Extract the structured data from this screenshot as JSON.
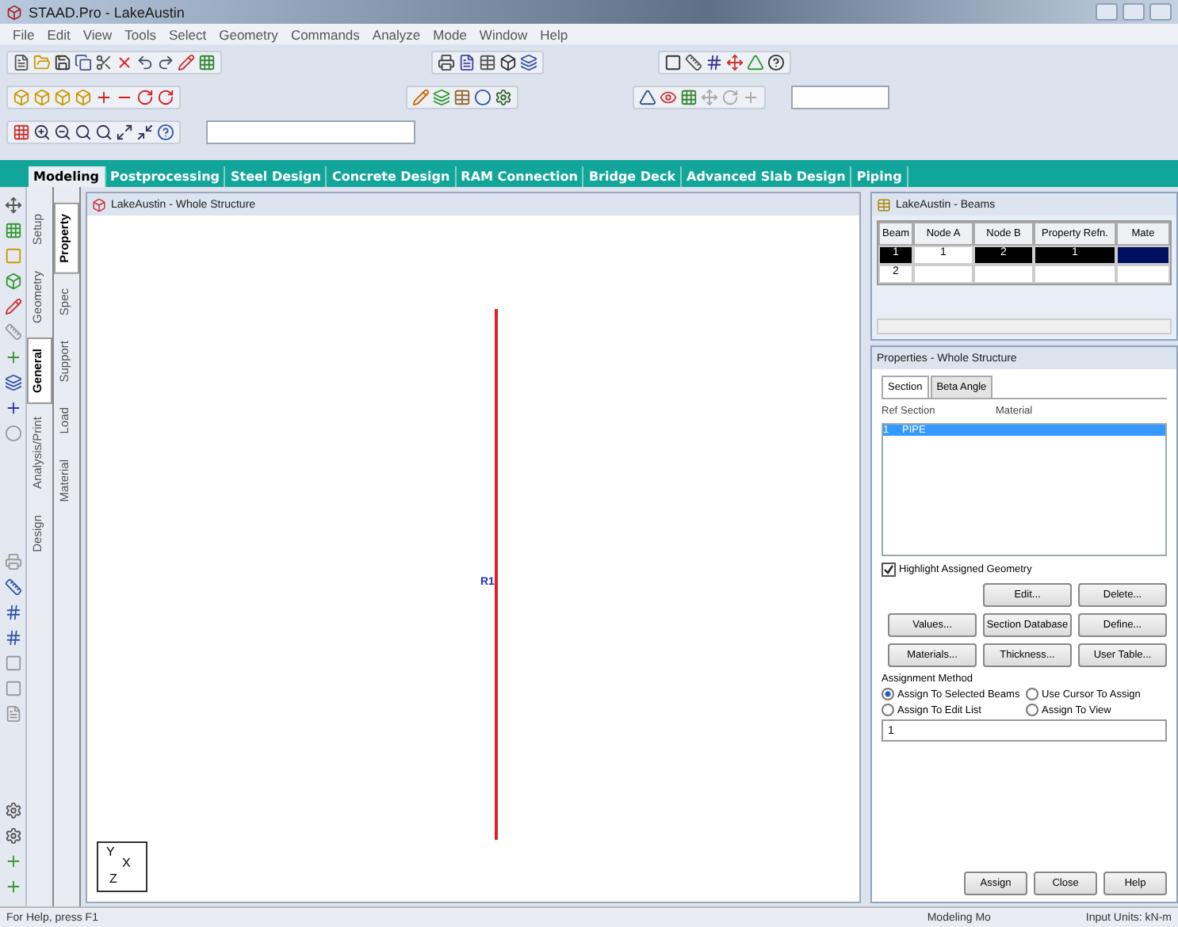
{
  "window": {
    "title": "STAAD.Pro - LakeAustin"
  },
  "menu": [
    "File",
    "Edit",
    "View",
    "Tools",
    "Select",
    "Geometry",
    "Commands",
    "Analyze",
    "Mode",
    "Window",
    "Help"
  ],
  "page_tabs": [
    {
      "label": "Modeling",
      "selected": true
    },
    {
      "label": "Postprocessing",
      "selected": false
    },
    {
      "label": "Steel Design",
      "selected": false
    },
    {
      "label": "Concrete Design",
      "selected": false
    },
    {
      "label": "RAM Connection",
      "selected": false
    },
    {
      "label": "Bridge Deck",
      "selected": false
    },
    {
      "label": "Advanced Slab Design",
      "selected": false
    },
    {
      "label": "Piping",
      "selected": false
    }
  ],
  "outer_tabs": [
    {
      "label": "Setup",
      "selected": false
    },
    {
      "label": "Geometry",
      "selected": false
    },
    {
      "label": "General",
      "selected": true
    },
    {
      "label": "Analysis/Print",
      "selected": false
    },
    {
      "label": "Design",
      "selected": false
    }
  ],
  "inner_tabs": [
    {
      "label": "Property",
      "selected": true
    },
    {
      "label": "Spec",
      "selected": false
    },
    {
      "label": "Support",
      "selected": false
    },
    {
      "label": "Load",
      "selected": false
    },
    {
      "label": "Material",
      "selected": false
    }
  ],
  "viewport": {
    "title": "LakeAustin - Whole Structure",
    "member_label": "R1",
    "axes": [
      "Y",
      "X",
      "Z"
    ]
  },
  "beams": {
    "title": "LakeAustin - Beams",
    "columns": [
      "Beam",
      "Node A",
      "Node B",
      "Property Refn.",
      "Mate"
    ],
    "rows": [
      {
        "cells": [
          "1",
          "1",
          "2",
          "1",
          ""
        ],
        "selected": true
      },
      {
        "cells": [
          "2",
          "",
          "",
          "",
          ""
        ],
        "selected": false
      }
    ]
  },
  "properties": {
    "title": "Properties - Whole Structure",
    "tabs": [
      {
        "label": "Section",
        "selected": true
      },
      {
        "label": "Beta Angle",
        "selected": false
      }
    ],
    "columns": [
      "Ref",
      "Section",
      "Material"
    ],
    "rows": [
      {
        "ref": "1",
        "section": "PIPE",
        "material": "",
        "selected": true
      }
    ],
    "highlight": {
      "label": "Highlight Assigned Geometry",
      "checked": true
    },
    "buttons": [
      [
        "Edit...",
        "Delete..."
      ],
      [
        "Values...",
        "Section Database",
        "Define..."
      ],
      [
        "Materials...",
        "Thickness...",
        "User Table..."
      ]
    ],
    "method_title": "Assignment Method",
    "methods": [
      {
        "label": "Assign To Selected Beams",
        "selected": true
      },
      {
        "label": "Use Cursor To Assign",
        "selected": false
      },
      {
        "label": "Assign To Edit List",
        "selected": false
      },
      {
        "label": "Assign To View",
        "selected": false
      }
    ],
    "edit_list": "1",
    "footer_buttons": [
      "Assign",
      "Close",
      "Help"
    ]
  },
  "status_bar": [
    "For Help, press F1",
    "Modeling Mo",
    "Input Units: kN-m"
  ]
}
